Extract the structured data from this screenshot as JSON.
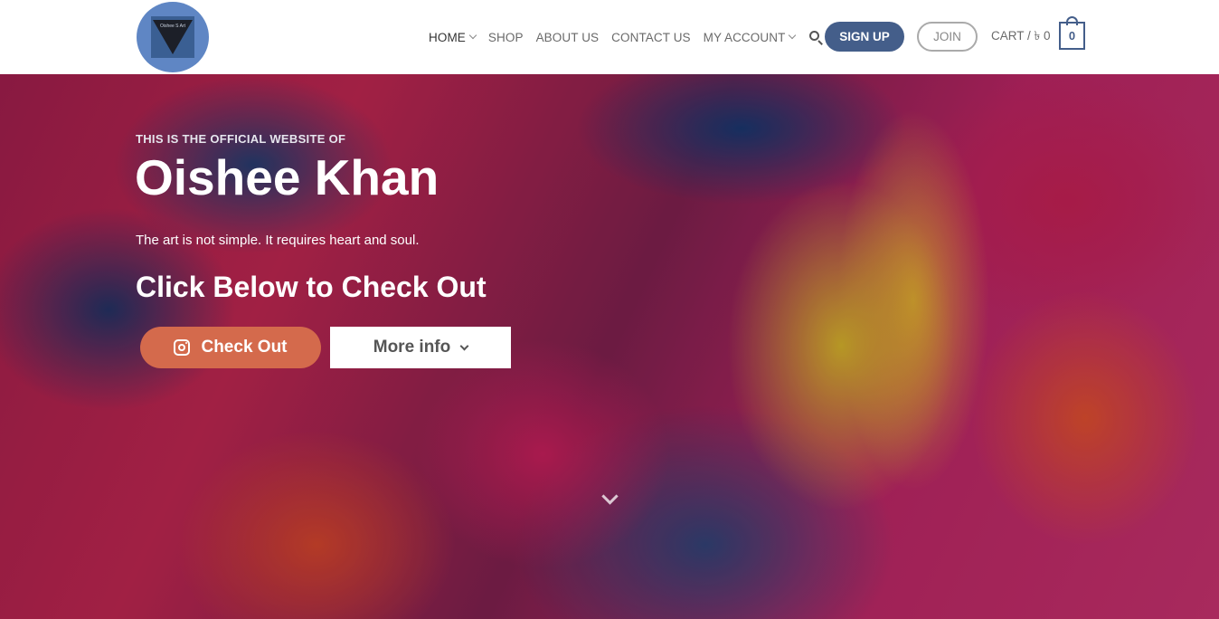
{
  "logo": {
    "text": "Oishee S Art"
  },
  "nav": {
    "items": [
      {
        "label": "HOME",
        "has_dropdown": true,
        "active": true
      },
      {
        "label": "SHOP",
        "has_dropdown": false,
        "active": false
      },
      {
        "label": "ABOUT US",
        "has_dropdown": false,
        "active": false
      },
      {
        "label": "CONTACT US",
        "has_dropdown": false,
        "active": false
      },
      {
        "label": "MY ACCOUNT",
        "has_dropdown": true,
        "active": false
      }
    ],
    "search_icon": "search-icon",
    "signup_label": "SIGN UP",
    "join_label": "JOIN",
    "cart_label": "CART / ৳ 0",
    "cart_count": "0"
  },
  "hero": {
    "eyebrow": "THIS IS THE OFFICIAL WEBSITE OF",
    "title": "Oishee Khan",
    "tagline": "The art is not simple. It requires heart and soul.",
    "subhead": "Click Below to Check Out",
    "checkout_label": "Check Out",
    "checkout_icon": "instagram-icon",
    "more_info_label": "More info",
    "scroll_icon": "chevron-down-icon"
  },
  "colors": {
    "primary": "#445e8a",
    "checkout": "#d46a4c"
  }
}
